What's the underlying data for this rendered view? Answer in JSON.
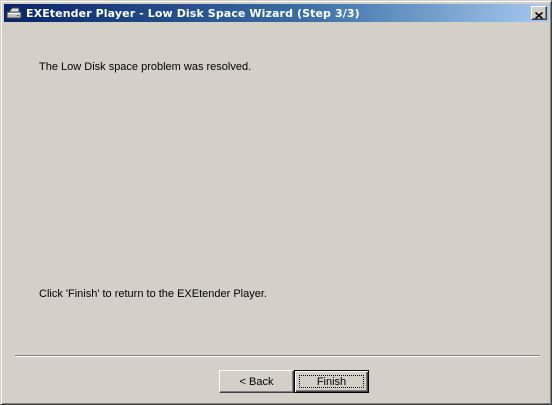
{
  "window": {
    "title": "EXEtender Player - Low Disk Space Wizard (Step 3/3)",
    "app_icon": "drive-icon",
    "close_glyph": "✕"
  },
  "content": {
    "message": "The Low Disk space problem was resolved.",
    "instruction": "Click 'Finish' to return to the EXEtender Player."
  },
  "buttons": {
    "back_label": "< Back",
    "finish_label": "Finish"
  },
  "colors": {
    "title_gradient_start": "#0a246a",
    "title_gradient_end": "#a6caf0",
    "face": "#d4d0c8"
  }
}
